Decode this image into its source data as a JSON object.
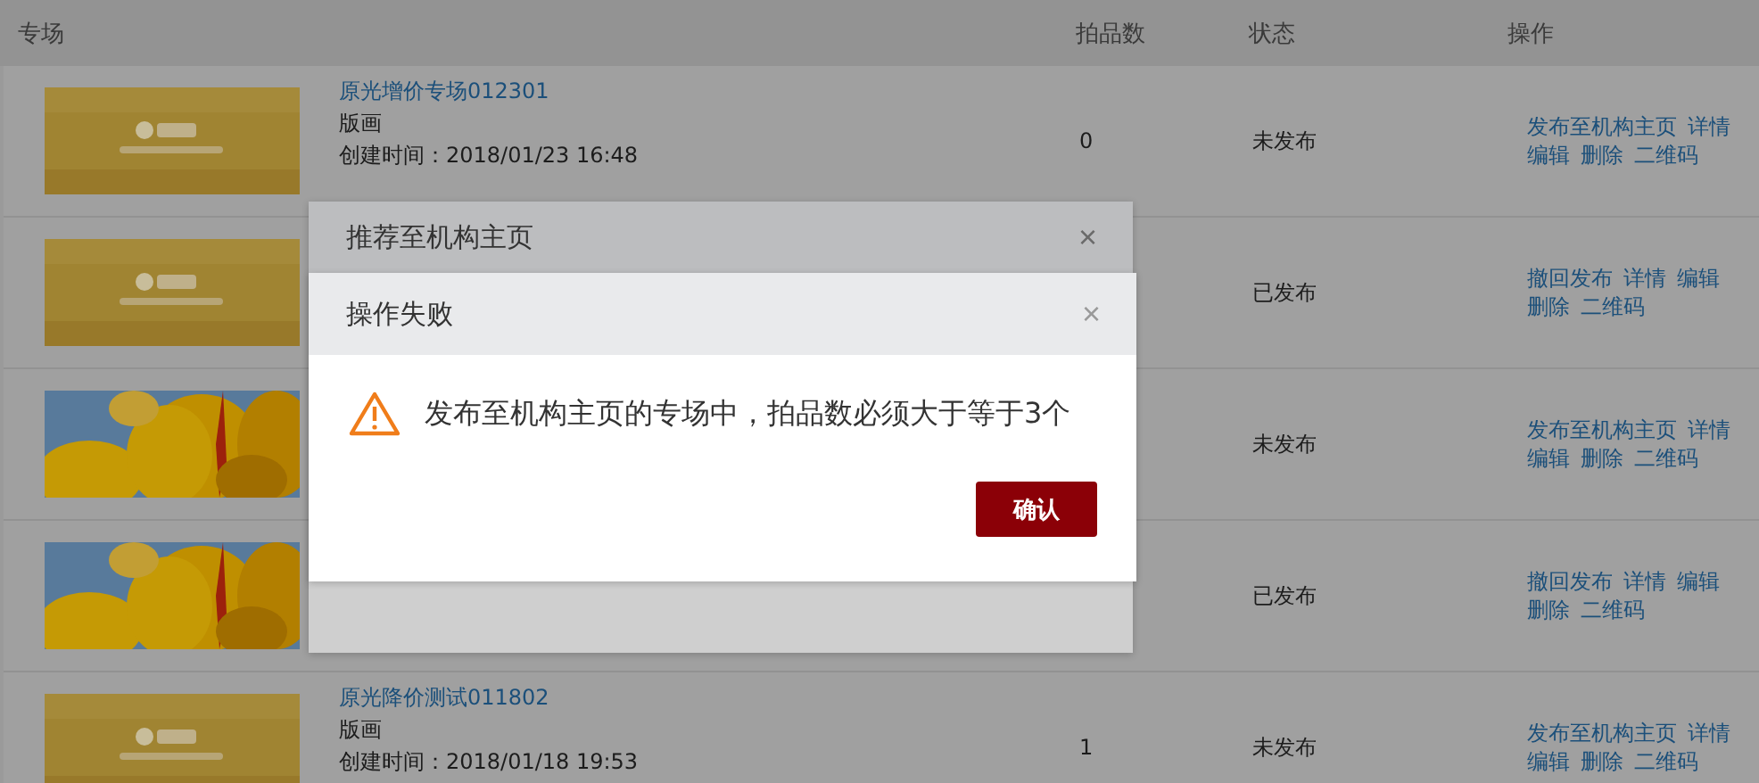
{
  "table": {
    "columns": [
      "专场",
      "拍品数",
      "状态",
      "操作"
    ],
    "rows": [
      {
        "name": "原光增价专场012301",
        "category": "版画",
        "created": "创建时间：2018/01/23 16:48",
        "count": "0",
        "status": "未发布",
        "actions": [
          "发布至机构主页",
          "详情",
          "编辑",
          "删除",
          "二维码"
        ]
      },
      {
        "status": "已发布",
        "actions": [
          "撤回发布",
          "详情",
          "编辑",
          "删除",
          "二维码"
        ]
      },
      {
        "status": "未发布",
        "actions": [
          "发布至机构主页",
          "详情",
          "编辑",
          "删除",
          "二维码"
        ]
      },
      {
        "status": "已发布",
        "actions": [
          "撤回发布",
          "详情",
          "编辑",
          "删除",
          "二维码"
        ]
      },
      {
        "name": "原光降价测试011802",
        "category": "版画",
        "created": "创建时间：2018/01/18 19:53",
        "count": "1",
        "status": "未发布",
        "actions": [
          "发布至机构主页",
          "详情",
          "编辑",
          "删除",
          "二维码"
        ]
      }
    ]
  },
  "back_dialog": {
    "title": "推荐至机构主页",
    "close": "×"
  },
  "dialog": {
    "title": "操作失败",
    "close": "×",
    "message": "发布至机构主页的专场中，拍品数必须大于等于3个",
    "confirm": "确认"
  }
}
